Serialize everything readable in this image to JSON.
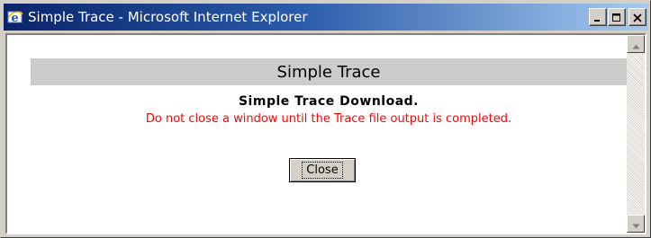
{
  "window": {
    "title": "Simple Trace - Microsoft Internet Explorer",
    "titlebar_colors": [
      "#0a246a",
      "#a6caf0"
    ],
    "buttons": {
      "minimize": "minimize-icon",
      "maximize": "maximize-icon",
      "close": "close-icon"
    }
  },
  "page": {
    "heading": "Simple Trace",
    "message_title": "Simple Trace Download.",
    "message_warning": "Do not close a window until the Trace file output is completed.",
    "warning_color": "#ff0000",
    "close_label": "Close"
  },
  "scrollbar": {
    "up": "arrow-up-icon",
    "down": "arrow-down-icon"
  }
}
